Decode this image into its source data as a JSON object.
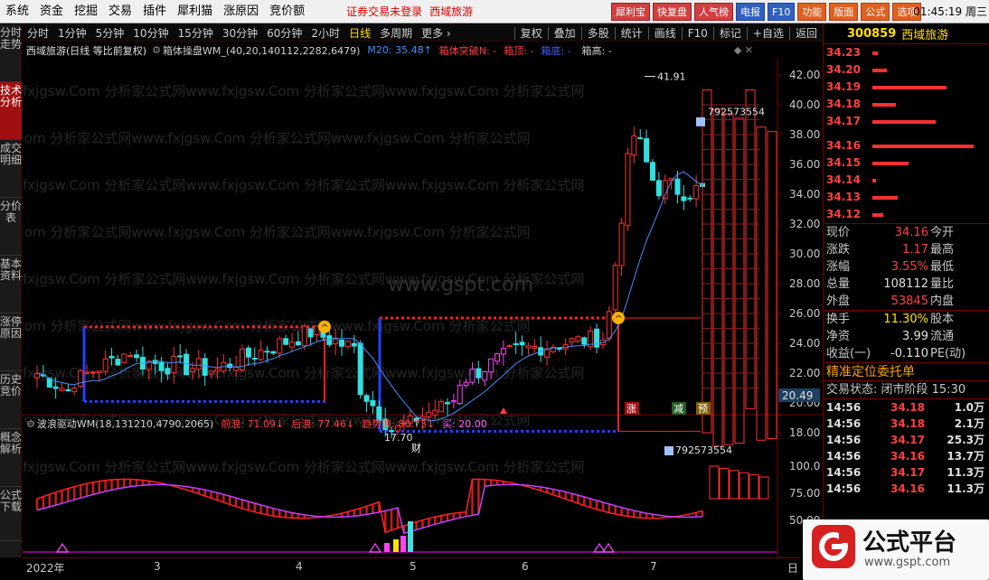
{
  "menubar": {
    "items": [
      "系统",
      "资金",
      "挖掘",
      "交易",
      "插件",
      "犀利猫",
      "涨原因",
      "竞价额"
    ],
    "warning": "证券交易未登录",
    "stock_name": "西域旅游",
    "buttons": [
      "犀利宝",
      "快复盘",
      "人气榜",
      "电报",
      "F10",
      "功能",
      "版面",
      "公式",
      "选项"
    ],
    "clock": "01:45:19 周三"
  },
  "left_tabs": [
    "分时走势",
    "技术分析",
    "成交明细",
    "分价表",
    "基本资料",
    "涨停原因",
    "历史竞价",
    "概念解析",
    "公式下载"
  ],
  "period_bar": {
    "items": [
      "分时",
      "1分钟",
      "5分钟",
      "10分钟",
      "15分钟",
      "30分钟",
      "60分钟",
      "2小时",
      "日线",
      "多周期",
      "更多 ›"
    ],
    "active": "日线",
    "tools": [
      "复权",
      "叠加",
      "多股",
      "统计",
      "画线",
      "F10",
      "标记",
      "+自选",
      "返回"
    ]
  },
  "chart_title": {
    "name": "西域旅游(日线 等比前复权)",
    "indicator": "箱体操盘WM_(40,20,140112,2282,6479)",
    "m20": "M20: 35.48↑",
    "breakout": "箱体突破N: -",
    "top": "箱顶: -",
    "bottom": "箱底: -",
    "height": "箱高: -"
  },
  "indicator_title": {
    "name": "波浪驱动WM(18,131210,4790,2065)",
    "front": "前浪: 71.09↓",
    "back": "后浪: 77.46↓",
    "trend": "趋势浪: 80.73↓",
    "buy": "买: 20.00"
  },
  "chart_labels": {
    "high": "41.91",
    "low": "17.70",
    "vol1": "792573554",
    "vol2": "792573554",
    "last": "20.49",
    "watermark_site": "www.gspt.com",
    "watermark_line": "fxjgsw.Com 分析家公式网www.fxjgsw.Com 分析家公式网www.fxjgsw.Com 分析家公式网",
    "marker_cai": "财",
    "marker_zhang": "涨",
    "marker_jian": "减",
    "marker_yu": "预"
  },
  "price_axis": [
    "42.00",
    "40.00",
    "38.00",
    "36.00",
    "34.00",
    "32.00",
    "30.00",
    "28.00",
    "26.00",
    "24.00",
    "22.00",
    "20.00",
    "18.00"
  ],
  "ind_axis": [
    "100.0",
    "75.00",
    "50.00"
  ],
  "date_axis": [
    "2022年",
    "3",
    "4",
    "5",
    "6",
    "7",
    "日"
  ],
  "quote": {
    "code": "300859",
    "name": "西域旅游",
    "orderbook": [
      {
        "price": "34.23",
        "bar": 6
      },
      {
        "price": "34.20",
        "bar": 16
      },
      {
        "price": "34.19",
        "bar": 82
      },
      {
        "price": "34.18",
        "bar": 26
      },
      {
        "price": "34.17",
        "bar": 70
      },
      {
        "price": "34.16",
        "bar": 112
      },
      {
        "price": "34.15",
        "bar": 40
      },
      {
        "price": "34.14",
        "bar": 4
      },
      {
        "price": "34.13",
        "bar": 28
      },
      {
        "price": "34.12",
        "bar": 12
      }
    ],
    "rows1": [
      {
        "l1": "现价",
        "v1": "34.16",
        "l2": "今开"
      },
      {
        "l1": "涨跌",
        "v1": "1.17",
        "l2": "最高"
      },
      {
        "l1": "涨幅",
        "v1": "3.55%",
        "l2": "最低"
      },
      {
        "l1": "总量",
        "v1": "108112",
        "l2": "量比"
      },
      {
        "l1": "外盘",
        "v1": "53845",
        "l2": "内盘"
      }
    ],
    "rows2": [
      {
        "l1": "换手",
        "v1": "11.30%",
        "l2": "股本"
      },
      {
        "l1": "净资",
        "v1": "3.99",
        "l2": "流通"
      },
      {
        "l1": "收益(一)",
        "v1": "-0.110",
        "l2": "PE(动)"
      }
    ],
    "section_title": "精准定位委托单",
    "status": "交易状态: 闭市阶段 15:30",
    "ticks": [
      {
        "time": "14:56",
        "price": "34.18",
        "vol": "1.0万"
      },
      {
        "time": "14:56",
        "price": "34.18",
        "vol": "2.1万"
      },
      {
        "time": "14:56",
        "price": "34.17",
        "vol": "25.3万"
      },
      {
        "time": "14:56",
        "price": "34.16",
        "vol": "13.7万"
      },
      {
        "time": "14:56",
        "price": "34.17",
        "vol": "11.3万"
      },
      {
        "time": "14:56",
        "price": "34.16",
        "vol": "11.3万"
      }
    ]
  },
  "logo": {
    "text": "公式平台",
    "url": "www.gspt.com"
  }
}
